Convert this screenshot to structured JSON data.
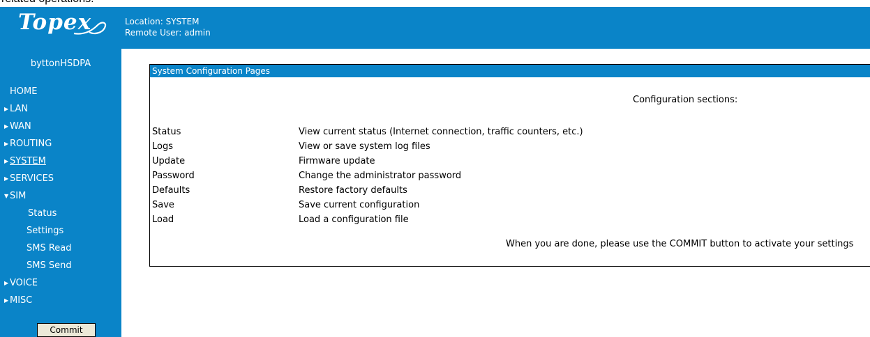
{
  "caption": "related operations.",
  "brand": {
    "logo_text": "Topex"
  },
  "header": {
    "location": "Location: SYSTEM",
    "remote_user": "Remote User: admin"
  },
  "sidebar": {
    "device_name": "byttonHSDPA",
    "menu": [
      {
        "label": "HOME",
        "arrow": ""
      },
      {
        "label": "LAN",
        "arrow": "▶"
      },
      {
        "label": "WAN",
        "arrow": "▶"
      },
      {
        "label": "ROUTING",
        "arrow": "▶"
      },
      {
        "label": "SYSTEM",
        "arrow": "▶"
      },
      {
        "label": "SERVICES",
        "arrow": "▶"
      },
      {
        "label": "SIM",
        "arrow": "▼"
      },
      {
        "label": "Status"
      },
      {
        "label": "Settings"
      },
      {
        "label": "SMS Read"
      },
      {
        "label": "SMS Send"
      },
      {
        "label": "VOICE",
        "arrow": "▶"
      },
      {
        "label": "MISC",
        "arrow": "▶"
      }
    ],
    "commit_label": "Commit"
  },
  "main": {
    "panel_title": "System Configuration Pages",
    "sections_heading": "Configuration sections:",
    "rows": [
      {
        "name": "Status",
        "desc": "View current status (Internet connection, traffic counters, etc.)"
      },
      {
        "name": "Logs",
        "desc": "View or save system log files"
      },
      {
        "name": "Update",
        "desc": "Firmware update"
      },
      {
        "name": "Password",
        "desc": "Change the administrator password"
      },
      {
        "name": "Defaults",
        "desc": "Restore factory defaults"
      },
      {
        "name": "Save",
        "desc": "Save current configuration"
      },
      {
        "name": "Load",
        "desc": "Load a configuration file"
      }
    ],
    "footer_note": "When you are done, please use the COMMIT button to activate your settings"
  },
  "colors": {
    "brand_blue": "#0a84c8"
  }
}
